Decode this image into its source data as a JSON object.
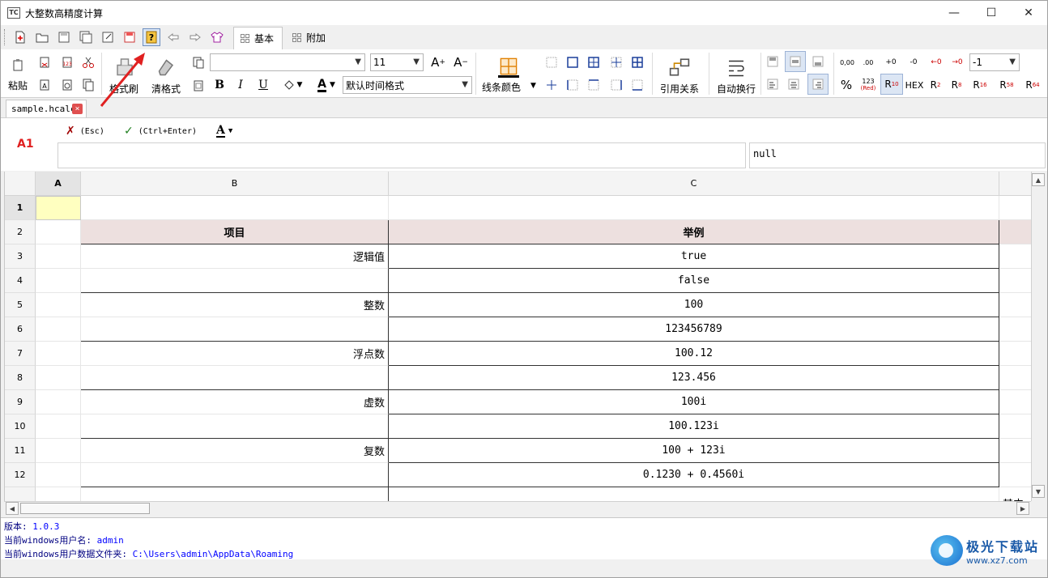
{
  "window": {
    "title": "大整数高精度计算",
    "minimize_glyph": "—",
    "maximize_glyph": "☐",
    "close_glyph": "✕"
  },
  "tabs": [
    {
      "label": "基本",
      "active": true
    },
    {
      "label": "附加",
      "active": false
    }
  ],
  "quick_toolbar": {
    "icons": [
      "new-file-icon",
      "open-folder-icon",
      "save-icon",
      "save-all-icon",
      "save-as-icon",
      "save-red-icon",
      "help-icon",
      "back-arrow-icon",
      "forward-arrow-icon",
      "shirt-icon"
    ]
  },
  "ribbon": {
    "paste_label": "粘贴",
    "format_brush_label": "格式刷",
    "clear_format_label": "清格式",
    "font_name": "",
    "font_size": "11",
    "bold_label": "B",
    "italic_label": "I",
    "underline_label": "U",
    "font_color_letter": "A",
    "time_format": "默认时间格式",
    "line_color_label": "线条颜色",
    "ref_label": "引用关系",
    "wrap_label": "自动换行",
    "decimal_select": "-1",
    "percent_label": "%",
    "num_123": "123",
    "num_red": "(Red)",
    "r10": "10",
    "r_letter": "R",
    "hex_label": "HEX",
    "r2": "2",
    "r8": "8",
    "r16": "16",
    "r58": "58",
    "r64": "64",
    "dec_labels": [
      "0,00",
      ".00",
      "+0",
      "-0",
      "←0",
      "→0"
    ]
  },
  "document_tab": {
    "name": "sample.hcalc",
    "close_glyph": "×"
  },
  "formula_bar": {
    "cell_ref": "A1",
    "cancel_label": "(Esc)",
    "confirm_label": "(Ctrl+Enter)",
    "cancel_glyph": "✗",
    "confirm_glyph": "✓",
    "value": "null"
  },
  "grid": {
    "columns": [
      "A",
      "B",
      "C"
    ],
    "rows": [
      "1",
      "2",
      "3",
      "4",
      "5",
      "6",
      "7",
      "8",
      "9",
      "10",
      "11",
      "12",
      ""
    ],
    "header": {
      "b": "项目",
      "c": "举例"
    },
    "data": [
      {
        "b": "逻辑值",
        "c": "true"
      },
      {
        "b": "",
        "c": "false"
      },
      {
        "b": "整数",
        "c": "100"
      },
      {
        "b": "",
        "c": "123456789"
      },
      {
        "b": "浮点数",
        "c": "100.12"
      },
      {
        "b": "",
        "c": "123.456"
      },
      {
        "b": "虚数",
        "c": "100i"
      },
      {
        "b": "",
        "c": "100.123i"
      },
      {
        "b": "复数",
        "c": "100 + 123i"
      },
      {
        "b": "",
        "c": "0.1230 + 0.4560i"
      }
    ],
    "partial_text": "其中"
  },
  "log": {
    "version_label": "版本:",
    "version_value": "1.0.3",
    "user_label": "当前windows用户名:",
    "user_value": "admin",
    "folder_label": "当前windows用户数据文件夹:",
    "folder_value": "C:\\Users\\admin\\AppData\\Roaming"
  },
  "watermark": {
    "brand": "极光下载站",
    "url": "www.xz7.com"
  },
  "colors": {
    "accent_red": "#e02020",
    "header_fill": "#ede0df",
    "selected_cell": "#ffffc0",
    "log_blue": "#0000ff"
  }
}
